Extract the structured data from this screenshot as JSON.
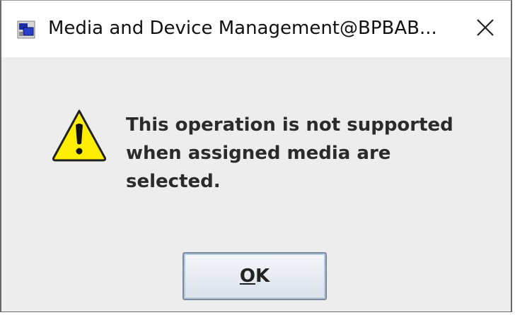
{
  "window": {
    "title": "Media and Device Management@BPBAB...",
    "app_icon": "app-window-icon",
    "close_icon": "close-icon",
    "close_glyph": "✕"
  },
  "dialog": {
    "icon": "warning-icon",
    "message": "This operation is not supported when assigned media are selected.",
    "ok_button": {
      "mnemonic": "O",
      "rest": "K"
    }
  },
  "colors": {
    "warning_fill": "#ffee00",
    "dialog_background": "#ededed",
    "button_border": "#7a8a9c"
  }
}
